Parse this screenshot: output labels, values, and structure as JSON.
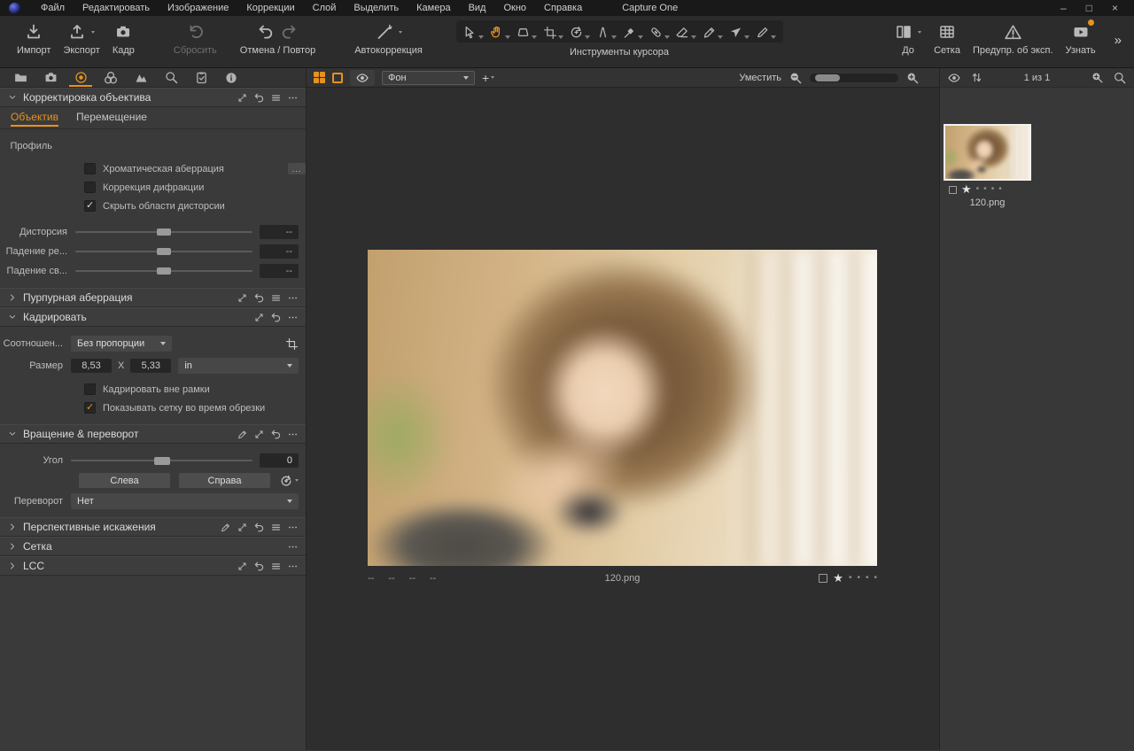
{
  "colors": {
    "accent": "#e8921e"
  },
  "window": {
    "app_title": "Capture One",
    "minimize": "–",
    "maximize": "□",
    "close": "×"
  },
  "menu": {
    "items": [
      "Файл",
      "Редактировать",
      "Изображение",
      "Коррекции",
      "Слой",
      "Выделить",
      "Камера",
      "Вид",
      "Окно",
      "Справка"
    ]
  },
  "toolbar": {
    "import_label": "Импорт",
    "export_label": "Экспорт",
    "capture_label": "Кадр",
    "reset_label": "Сбросить",
    "undo_redo_label": "Отмена / Повтор",
    "autocorrect_label": "Автокоррекция",
    "cursor_tools_label": "Инструменты курсора",
    "cursor_tools": [
      "select",
      "pan",
      "keystone",
      "crop",
      "rotate",
      "straighten",
      "spot-brush",
      "heal",
      "erase",
      "draw-mask",
      "magic-brush",
      "annotate"
    ],
    "active_cursor_tool": "pan",
    "before_label": "До",
    "grid_label": "Сетка",
    "exposure_warning_label": "Предупр. об эксп.",
    "learn_label": "Узнать",
    "more_chevrons": "»"
  },
  "left_panel": {
    "tool_tabs": [
      "library",
      "capture",
      "lens",
      "color",
      "styles",
      "loupe",
      "metadata",
      "info"
    ],
    "active_tool_tab": "lens",
    "lens_correction": {
      "title": "Корректировка объектива",
      "tabs": {
        "lens": "Объектив",
        "movement": "Перемещение"
      },
      "active_tab": "Объектив",
      "profile_label": "Профиль",
      "more_button": "...",
      "checkboxes": [
        {
          "label": "Хроматическая аберрация",
          "checked": false
        },
        {
          "label": "Коррекция дифракции",
          "checked": false
        },
        {
          "label": "Скрыть области дисторсии",
          "checked": true
        }
      ],
      "sliders": [
        {
          "label": "Дисторсия",
          "value": "--"
        },
        {
          "label": "Падение ре...",
          "value": "--"
        },
        {
          "label": "Падение св...",
          "value": "--"
        }
      ]
    },
    "purple_fringing": {
      "title": "Пурпурная аберрация"
    },
    "crop": {
      "title": "Кадрировать",
      "ratio_label": "Соотношен...",
      "ratio_value": "Без пропорции",
      "size_label": "Размер",
      "size_width": "8,53",
      "size_separator": "X",
      "size_height": "5,33",
      "size_unit": "in",
      "checkboxes": [
        {
          "label": "Кадрировать вне рамки",
          "checked": false
        },
        {
          "label": "Показывать сетку во время обрезки",
          "checked": true
        }
      ]
    },
    "rotation_flip": {
      "title": "Вращение & переворот",
      "angle_label": "Угол",
      "angle_value": "0",
      "left_button": "Слева",
      "right_button": "Справа",
      "flip_label": "Переворот",
      "flip_value": "Нет"
    },
    "keystone": {
      "title": "Перспективные искажения"
    },
    "grid": {
      "title": "Сетка"
    },
    "lcc": {
      "title": "LCC"
    }
  },
  "viewer": {
    "background_select": "Фон",
    "fit_label": "Уместить",
    "filename": "120.png",
    "exif_placeholders": [
      "--",
      "--",
      "--",
      "--"
    ],
    "rating": {
      "star": "★",
      "dot": "•",
      "stars_filled": 1,
      "stars_total": 5
    }
  },
  "browser": {
    "count_label": "1 из 1",
    "thumbnail": {
      "filename": "120.png",
      "star": "★",
      "dot": "•",
      "stars_filled": 1
    }
  }
}
